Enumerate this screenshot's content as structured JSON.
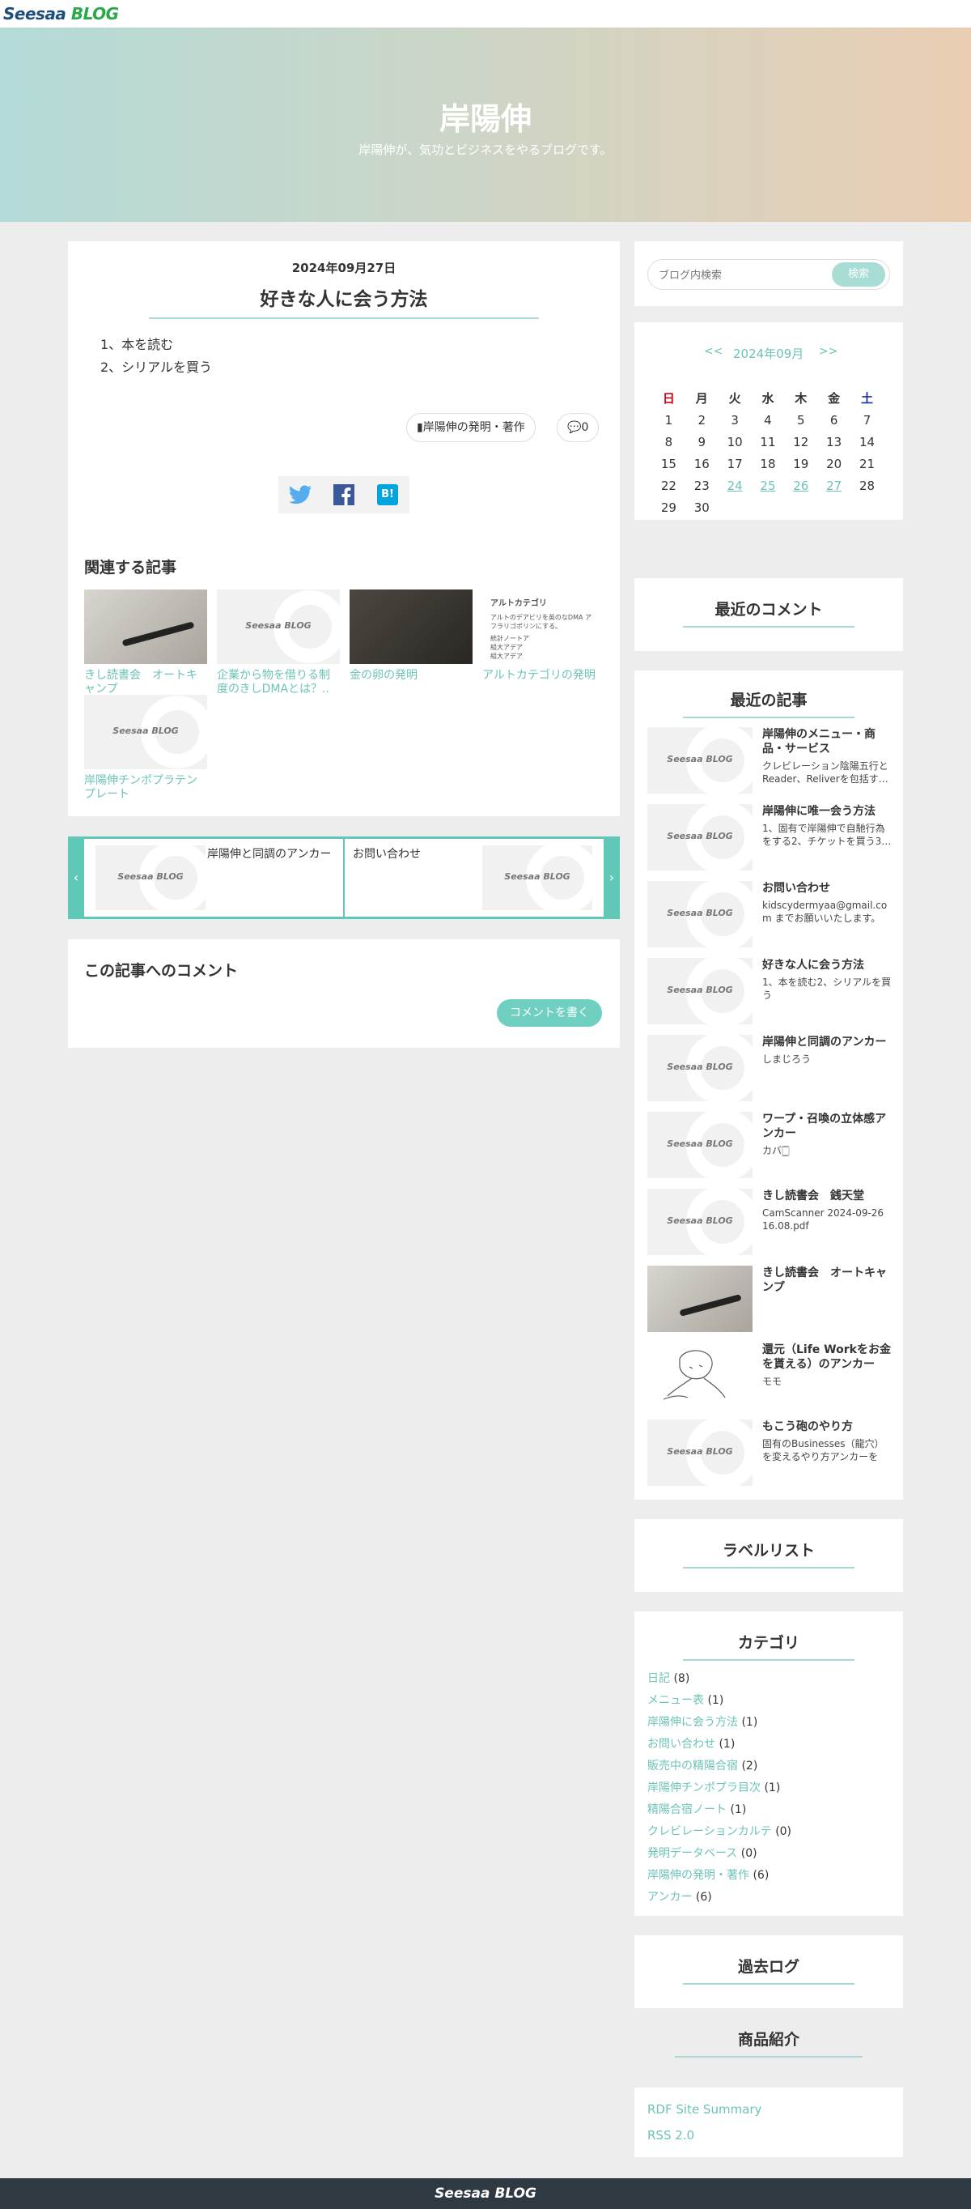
{
  "topbar": {
    "logo_main": "Seesaa",
    "logo_sub": "BLOG"
  },
  "hero": {
    "title": "岸陽伸",
    "subtitle": "岸陽伸が、気功とビジネスをやるブログです。"
  },
  "article": {
    "date": "2024年09月27日",
    "title": "好きな人に会う方法",
    "lines": [
      "1、本を読む",
      "2、シリアルを買う"
    ],
    "category": "岸陽伸の発明・著作",
    "comment_count": "0",
    "share": {
      "twitter": "twitter-icon",
      "facebook": "facebook-icon",
      "hatena": "B!"
    }
  },
  "related": {
    "heading": "関連する記事",
    "items": [
      {
        "caption": "きし読書会　オートキャンプ",
        "thumb": "photo"
      },
      {
        "caption": "企業から物を借りる制度のきしDMAとは？..",
        "thumb": "placeholder"
      },
      {
        "caption": "金の卵の発明",
        "thumb": "dark"
      },
      {
        "caption": "アルトカテゴリの発明",
        "thumb": "doc"
      },
      {
        "caption": "岸陽伸チンポプラテンプレート",
        "thumb": "placeholder"
      }
    ],
    "doc_thumb": {
      "title": "アルトカテゴリ",
      "l1": "アルトのデアビリを英のなDMA アフラリゴポリンにする。",
      "l2": "統計ノートア",
      "l3": "組大アデア",
      "l4": "組大アデア"
    }
  },
  "pager": {
    "prev_title": "岸陽伸と同調のアンカー",
    "next_title": "お問い合わせ",
    "prev_icon": "chevron-left-icon",
    "next_icon": "chevron-right-icon"
  },
  "comments": {
    "heading": "この記事へのコメント",
    "button": "コメントを書く"
  },
  "search": {
    "placeholder": "ブログ内検索",
    "button": "検索"
  },
  "calendar": {
    "prev": "<<",
    "month": "2024年09月",
    "next": ">>",
    "weekdays": [
      "日",
      "月",
      "火",
      "水",
      "木",
      "金",
      "土"
    ],
    "weeks": [
      [
        "1",
        "2",
        "3",
        "4",
        "5",
        "6",
        "7"
      ],
      [
        "8",
        "9",
        "10",
        "11",
        "12",
        "13",
        "14"
      ],
      [
        "15",
        "16",
        "17",
        "18",
        "19",
        "20",
        "21"
      ],
      [
        "22",
        "23",
        "24",
        "25",
        "26",
        "27",
        "28"
      ],
      [
        "29",
        "30",
        "",
        "",
        "",
        "",
        ""
      ]
    ],
    "linked_days": [
      "24",
      "25",
      "26",
      "27"
    ],
    "colors": {
      "sunday": "#d0021b",
      "saturday": "#1f2fa0",
      "link": "#6cc3b8"
    }
  },
  "recent_comments": {
    "heading": "最近のコメント"
  },
  "recent_articles": {
    "heading": "最近の記事",
    "items": [
      {
        "title": "岸陽伸のメニュー・商品・サービス",
        "desc": "クレビレーション陰陽五行とReader、Reliverを包括す…",
        "thumb": "placeholder"
      },
      {
        "title": "岸陽伸に唯一会う方法",
        "desc": "1、固有で岸陽伸で自馳行為をする2、チケットを買う3…",
        "thumb": "placeholder"
      },
      {
        "title": "お問い合わせ",
        "desc": "kidscydermyaa@gmail.com までお願いいたします。",
        "thumb": "placeholder"
      },
      {
        "title": "好きな人に会う方法",
        "desc": "1、本を読む2、シリアルを買う",
        "thumb": "placeholder"
      },
      {
        "title": "岸陽伸と同調のアンカー",
        "desc": "しまじろう",
        "thumb": "placeholder"
      },
      {
        "title": "ワープ・召喚の立体感アンカー",
        "desc": "カバ🀆",
        "thumb": "placeholder"
      },
      {
        "title": "きし読書会　銭天堂",
        "desc": "CamScanner 2024-09-26 16.08.pdf",
        "thumb": "placeholder"
      },
      {
        "title": "きし読書会　オートキャンプ",
        "desc": "",
        "thumb": "photo"
      },
      {
        "title": "還元（Life Workをお金を貰える）のアンカー",
        "desc": "モモ",
        "thumb": "sketch"
      },
      {
        "title": "もこう砲のやり方",
        "desc": "固有のBusinesses（龍穴）を変えるやり方アンカーを紙…",
        "thumb": "placeholder"
      }
    ]
  },
  "labels": {
    "heading": "ラベルリスト"
  },
  "categories": {
    "heading": "カテゴリ",
    "items": [
      {
        "name": "日記",
        "count": "(8)"
      },
      {
        "name": "メニュー表",
        "count": "(1)"
      },
      {
        "name": "岸陽伸に会う方法",
        "count": "(1)"
      },
      {
        "name": "お問い合わせ",
        "count": "(1)"
      },
      {
        "name": "販売中の精陽合宿",
        "count": "(2)"
      },
      {
        "name": "岸陽伸チンポプラ目次",
        "count": "(1)"
      },
      {
        "name": "精陽合宿ノート",
        "count": "(1)"
      },
      {
        "name": "クレビレーションカルテ",
        "count": "(0)"
      },
      {
        "name": "発明データベース",
        "count": "(0)"
      },
      {
        "name": "岸陽伸の発明・著作",
        "count": "(6)"
      },
      {
        "name": "アンカー",
        "count": "(6)"
      }
    ]
  },
  "archive": {
    "heading": "過去ログ"
  },
  "products": {
    "heading": "商品紹介"
  },
  "feeds": {
    "rdf": "RDF Site Summary",
    "rss": "RSS 2.0"
  },
  "footer": {
    "logo": "Seesaa BLOG"
  },
  "placeholder_watermark": "Seesaa BLOG"
}
